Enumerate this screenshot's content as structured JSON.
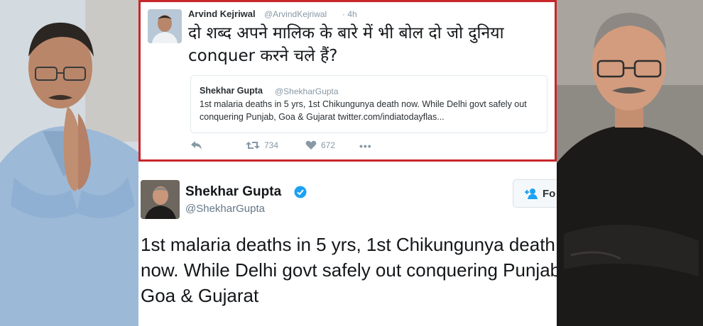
{
  "top_tweet": {
    "author_name": "Arvind Kejriwal",
    "author_handle": "@ArvindKejriwal",
    "time": "· 4h",
    "text": "दो शब्द अपने मालिक के बारे में भी बोल दो जो दुनिया conquer करने चले हैं?",
    "quoted": {
      "author_name": "Shekhar Gupta",
      "author_handle": "@ShekharGupta",
      "text": "1st malaria deaths in 5 yrs, 1st Chikungunya death now. While Delhi govt safely out conquering Punjab, Goa & Gujarat twitter.com/indiatodayflas..."
    },
    "actions": {
      "retweets": "734",
      "likes": "672",
      "more": "•••"
    },
    "border_color": "#c8262b"
  },
  "bottom_tweet": {
    "author_name": "Shekhar Gupta",
    "author_handle": "@ShekharGupta",
    "follow_label": "Fo",
    "text": "1st malaria deaths in 5 yrs, 1st Chikungunya death now. While Delhi govt safely out conquering Punjab, Goa & Gujarat",
    "verified_color": "#1da1f2"
  },
  "icons": {
    "reply": "reply-icon",
    "retweet": "retweet-icon",
    "like": "heart-icon",
    "more": "more-icon",
    "verified": "verified-badge-icon",
    "follow": "add-user-icon"
  }
}
